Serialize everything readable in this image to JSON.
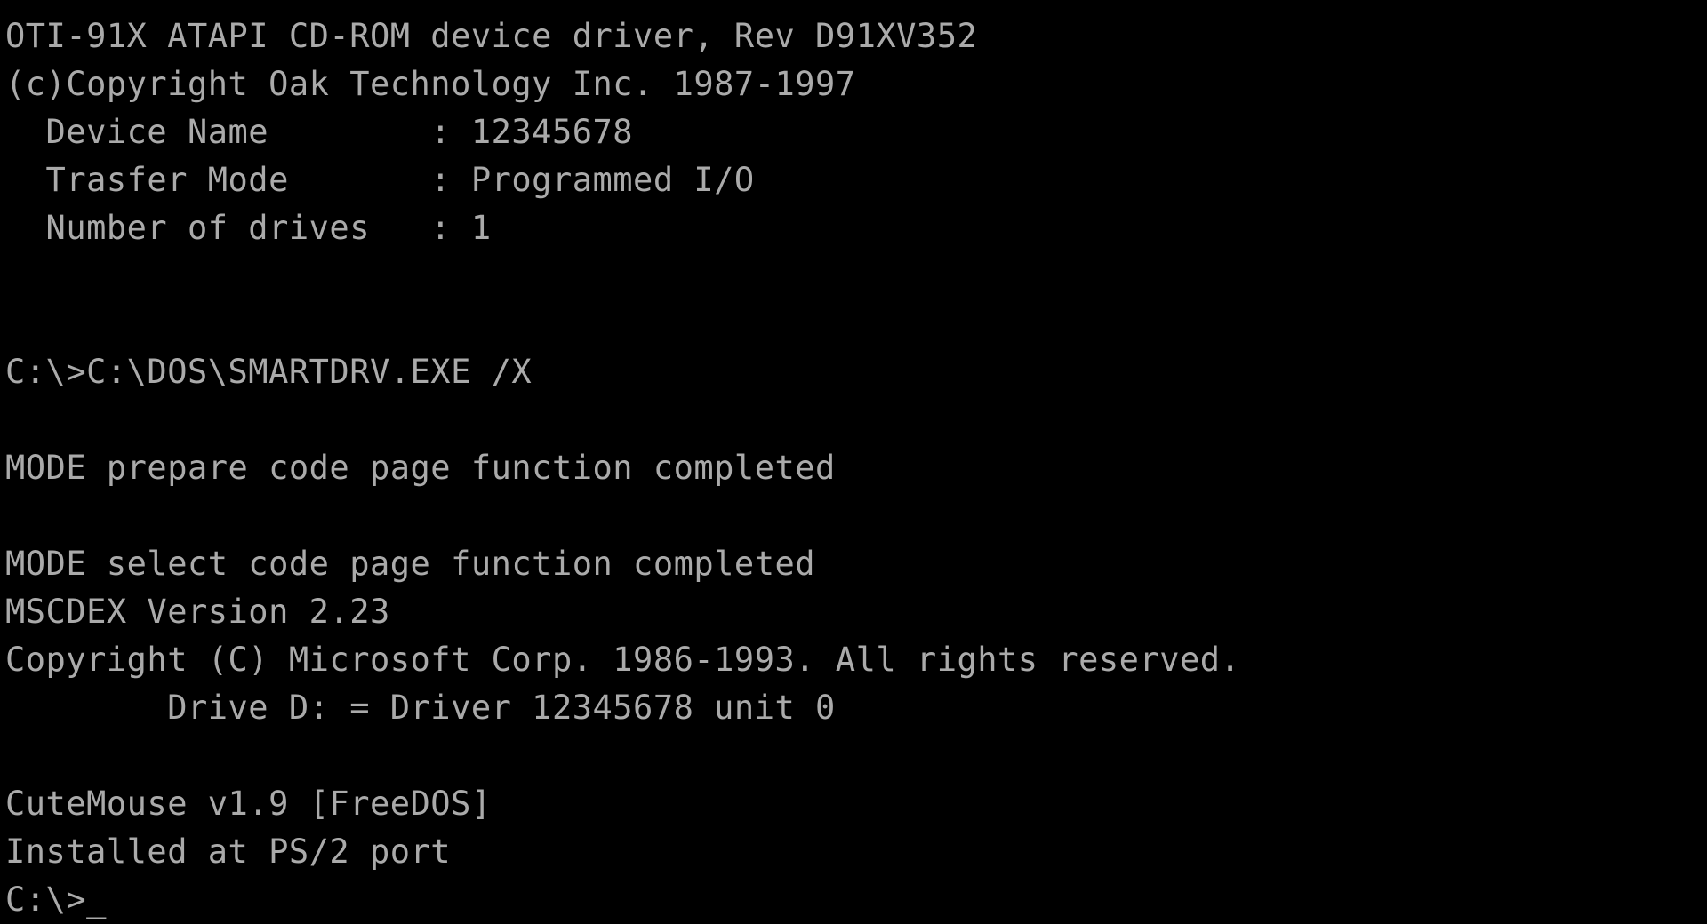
{
  "terminal": {
    "app": "MS-DOS Console",
    "background_color": "#000000",
    "text_color": "#aaaaaa",
    "cursor_glyph": "_",
    "columns": 80,
    "prompt": "C:\\>",
    "lines": [
      {
        "id": "driver-banner",
        "text": "OTI-91X ATAPI CD-ROM device driver, Rev D91XV352"
      },
      {
        "id": "driver-copyright",
        "text": "(c)Copyright Oak Technology Inc. 1987-1997"
      },
      {
        "id": "device-name-row",
        "text": "  Device Name        : 12345678"
      },
      {
        "id": "transfer-mode-row",
        "text": "  Trasfer Mode       : Programmed I/O"
      },
      {
        "id": "number-of-drives-row",
        "text": "  Number of drives   : 1"
      },
      {
        "id": "blank-1",
        "text": ""
      },
      {
        "id": "blank-2",
        "text": ""
      },
      {
        "id": "smartdrv-command",
        "text": "C:\\>C:\\DOS\\SMARTDRV.EXE /X"
      },
      {
        "id": "blank-3",
        "text": ""
      },
      {
        "id": "mode-prepare-status",
        "text": "MODE prepare code page function completed"
      },
      {
        "id": "blank-4",
        "text": ""
      },
      {
        "id": "mode-select-status",
        "text": "MODE select code page function completed"
      },
      {
        "id": "mscdex-version",
        "text": "MSCDEX Version 2.23"
      },
      {
        "id": "mscdex-copyright",
        "text": "Copyright (C) Microsoft Corp. 1986-1993. All rights reserved."
      },
      {
        "id": "drive-assignment",
        "text": "        Drive D: = Driver 12345678 unit 0"
      },
      {
        "id": "blank-5",
        "text": ""
      },
      {
        "id": "cutemouse-banner",
        "text": "CuteMouse v1.9 [FreeDOS]"
      },
      {
        "id": "cutemouse-port",
        "text": "Installed at PS/2 port"
      },
      {
        "id": "current-prompt",
        "text": "C:\\>_"
      }
    ],
    "details": {
      "driver_name": "OTI-91X ATAPI CD-ROM device driver",
      "driver_revision": "D91XV352",
      "driver_vendor": "Oak Technology Inc.",
      "driver_copyright_years": "1987-1997",
      "device_name_label": "Device Name",
      "device_name_value": "12345678",
      "transfer_mode_label": "Trasfer Mode",
      "transfer_mode_value": "Programmed I/O",
      "number_of_drives_label": "Number of drives",
      "number_of_drives_value": "1",
      "smartdrv_path": "C:\\DOS\\SMARTDRV.EXE",
      "smartdrv_switch": "/X",
      "mscdex_version": "2.23",
      "mscdex_copyright": "Copyright (C) Microsoft Corp. 1986-1993. All rights reserved.",
      "cdrom_drive_letter": "D:",
      "cdrom_driver_unit": "0",
      "mouse_driver": "CuteMouse",
      "mouse_driver_version": "v1.9",
      "mouse_driver_flavor": "[FreeDOS]",
      "mouse_port": "PS/2"
    }
  }
}
